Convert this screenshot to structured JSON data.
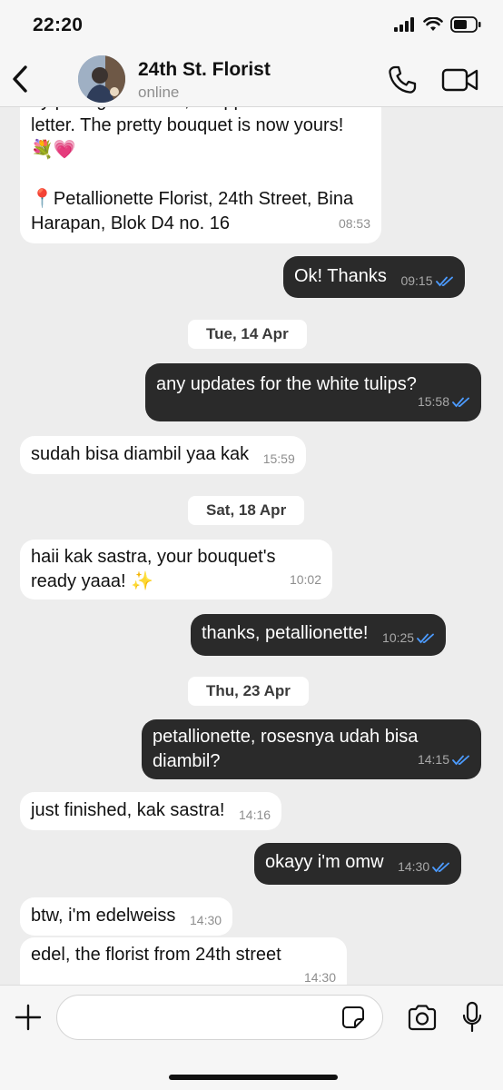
{
  "status_bar": {
    "time": "22:20"
  },
  "header": {
    "contact_name": "24th St. Florist",
    "contact_status": "online"
  },
  "messages": [
    {
      "dir": "in",
      "text": "by pure gentleness, wrapped in love letter. The pretty bouquet is now yours! 💐💗\n\n📍Petallionette Florist, 24th Street, Bina Harapan, Blok D4 no. 16",
      "time": "08:53"
    },
    {
      "dir": "out",
      "text": "Ok! Thanks",
      "time": "09:15"
    },
    {
      "date": "Tue, 14 Apr"
    },
    {
      "dir": "out",
      "text": "any updates for the white tulips?",
      "time": "15:58"
    },
    {
      "dir": "in",
      "text": "sudah bisa diambil yaa kak",
      "time": "15:59"
    },
    {
      "date": "Sat, 18 Apr"
    },
    {
      "dir": "in",
      "text": "haii kak sastra, your bouquet's ready yaaa! ✨",
      "time": "10:02"
    },
    {
      "dir": "out",
      "text": "thanks, petallionette!",
      "time": "10:25"
    },
    {
      "date": "Thu, 23 Apr"
    },
    {
      "dir": "out",
      "text": "petallionette, rosesnya udah bisa diambil?",
      "time": "14:15"
    },
    {
      "dir": "in",
      "text": "just finished, kak sastra!",
      "time": "14:16"
    },
    {
      "dir": "out",
      "text": "okayy i'm omw",
      "time": "14:30"
    },
    {
      "dir": "in",
      "text": "btw, i'm edelweiss",
      "time": "14:30"
    },
    {
      "dir": "in",
      "text": "edel, the florist from 24th street",
      "time": "14:30"
    }
  ],
  "composer": {
    "placeholder": ""
  },
  "colors": {
    "outgoing_bubble": "#2a2a2a",
    "incoming_bubble": "#ffffff",
    "read_tick": "#4c9bff",
    "chat_background": "#ededed"
  },
  "icons": [
    "chevron-left-icon",
    "phone-icon",
    "video-icon",
    "plus-icon",
    "sticker-icon",
    "camera-icon",
    "microphone-icon",
    "double-check-icon",
    "signal-icon",
    "wifi-icon",
    "battery-icon"
  ]
}
